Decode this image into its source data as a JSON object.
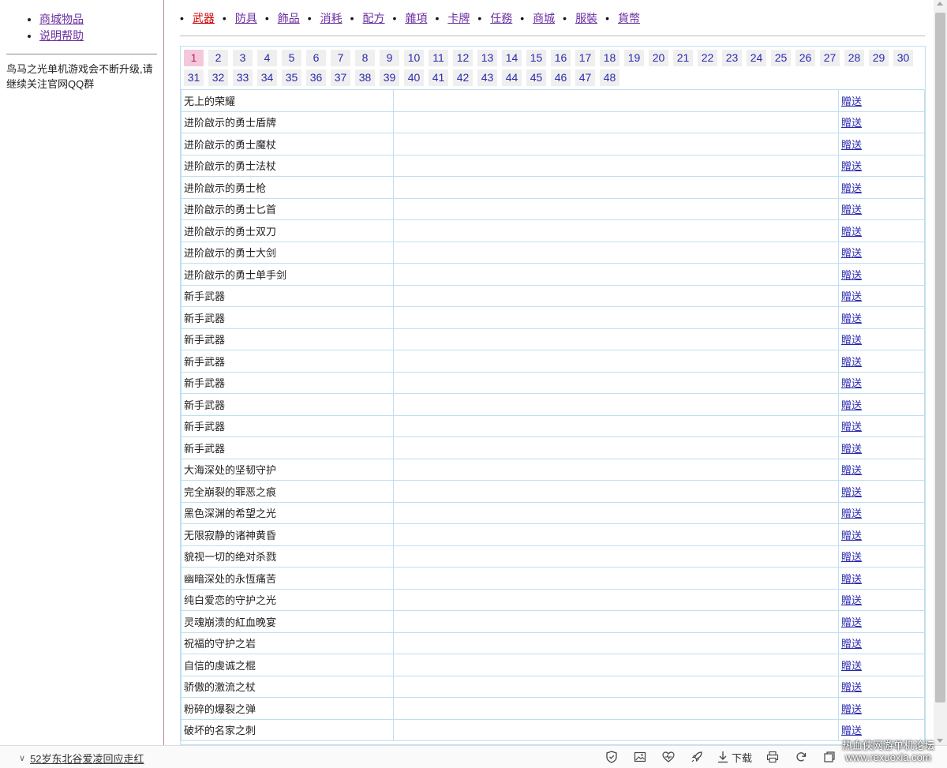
{
  "sidebar": {
    "links": [
      {
        "label": "商城物品"
      },
      {
        "label": "说明帮助"
      }
    ],
    "notice": "鸟马之光单机游戏会不断升级,请继续关注官网QQ群"
  },
  "topnav": {
    "items": [
      {
        "label": "武器",
        "active": true
      },
      {
        "label": "防具"
      },
      {
        "label": "飾品"
      },
      {
        "label": "消耗"
      },
      {
        "label": "配方"
      },
      {
        "label": "雜項"
      },
      {
        "label": "卡牌"
      },
      {
        "label": "任務"
      },
      {
        "label": "商城"
      },
      {
        "label": "服裝"
      },
      {
        "label": "貨幣"
      }
    ]
  },
  "pager": {
    "current": "1",
    "pages": [
      "1",
      "2",
      "3",
      "4",
      "5",
      "6",
      "7",
      "8",
      "9",
      "10",
      "11",
      "12",
      "13",
      "14",
      "15",
      "16",
      "17",
      "18",
      "19",
      "20",
      "21",
      "22",
      "23",
      "24",
      "25",
      "26",
      "27",
      "28",
      "29",
      "30",
      "31",
      "32",
      "33",
      "34",
      "35",
      "36",
      "37",
      "38",
      "39",
      "40",
      "41",
      "42",
      "43",
      "44",
      "45",
      "46",
      "47",
      "48"
    ]
  },
  "table": {
    "action_label": "贈送",
    "rows": [
      "无上的荣耀",
      "进阶啟示的勇士盾牌",
      "进阶啟示的勇士魔杖",
      "进阶啟示的勇士法杖",
      "进阶啟示的勇士枪",
      "进阶啟示的勇士匕首",
      "进阶啟示的勇士双刀",
      "进阶啟示的勇士大剑",
      "进阶啟示的勇士单手剑",
      "新手武器",
      "新手武器",
      "新手武器",
      "新手武器",
      "新手武器",
      "新手武器",
      "新手武器",
      "新手武器",
      "大海深处的坚韧守护",
      "完全崩裂的罪恶之痕",
      "黑色深渊的希望之光",
      "无限寂静的诸神黄昏",
      "貌视一切的绝对杀戮",
      "幽暗深处的永恆痛苦",
      "纯白爱恋的守护之光",
      "灵魂崩溃的紅血晚宴",
      "祝福的守护之岩",
      "自信的虔诚之棍",
      "骄傲的激流之杖",
      "粉碎的爆裂之弹",
      "破坏的名家之刺"
    ]
  },
  "bottombar": {
    "news": "52岁东北谷爱凌回应走红",
    "download_label": "下载",
    "watermark_line1": "热血侠网游单机论坛",
    "watermark_line2": "www.rexuexia.com"
  }
}
